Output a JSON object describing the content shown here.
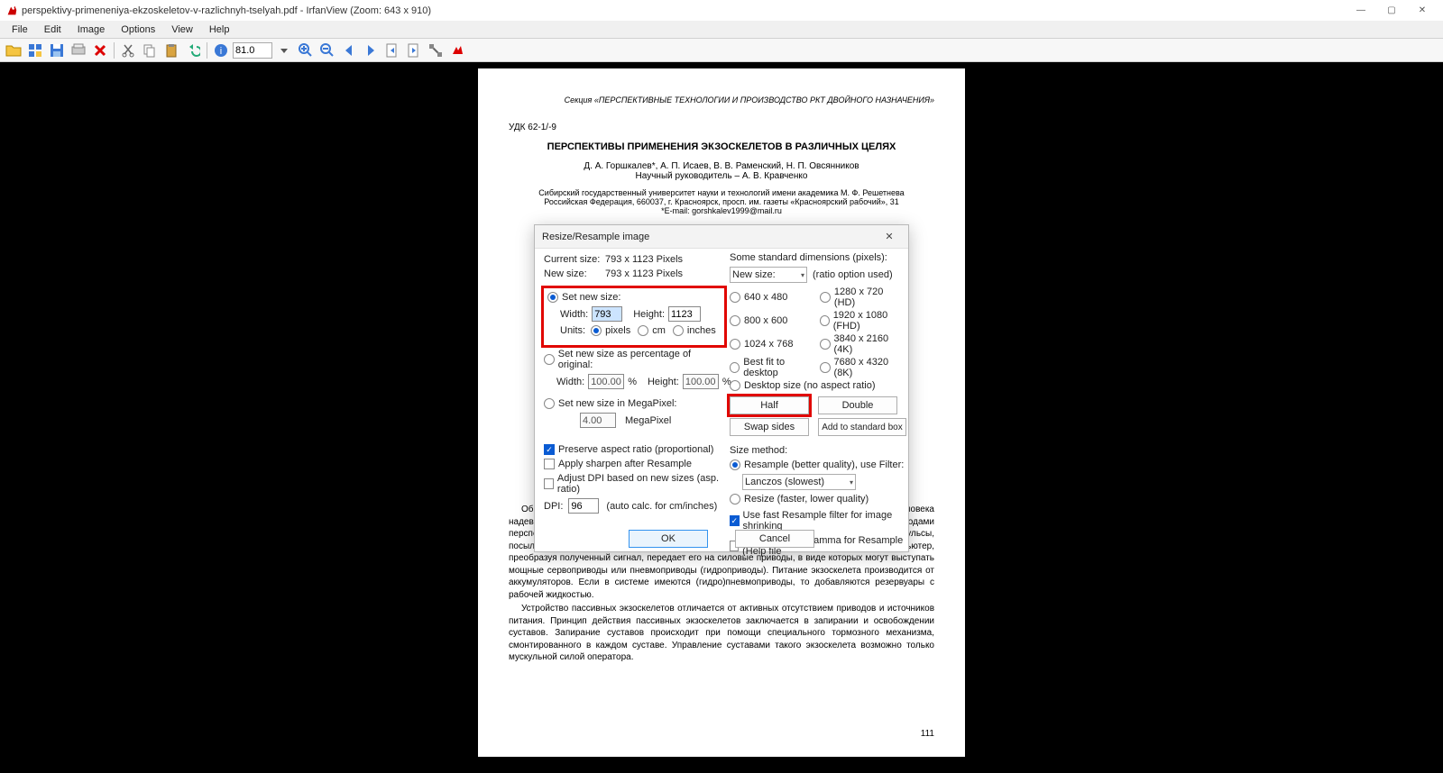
{
  "window": {
    "title": "perspektivy-primeneniya-ekzoskeletov-v-razlichnyh-tselyah.pdf - IrfanView (Zoom: 643 x 910)",
    "min": "—",
    "max": "▢",
    "close": "✕"
  },
  "menu": {
    "items": [
      "File",
      "Edit",
      "Image",
      "Options",
      "View",
      "Help"
    ]
  },
  "toolbar": {
    "zoom": "81.0"
  },
  "doc": {
    "section": "Секция «ПЕРСПЕКТИВНЫЕ ТЕХНОЛОГИИ И ПРОИЗВОДСТВО РКТ ДВОЙНОГО НАЗНАЧЕНИЯ»",
    "udk": "УДК 62-1/-9",
    "title": "ПЕРСПЕКТИВЫ ПРИМЕНЕНИЯ ЭКЗОСКЕЛЕТОВ В РАЗЛИЧНЫХ ЦЕЛЯХ",
    "authors": "Д. А. Горшкалев*, А. П. Исаев, В. В. Раменский, Н. П. Овсянников",
    "supervisor": "Научный руководитель – А. В. Кравченко",
    "affil1": "Сибирский государственный университет науки и технологий имени академика М. Ф. Решетнева",
    "affil2": "Российская Федерация, 660037, г. Красноярск, просп. им. газеты «Красноярский рабочий», 31",
    "affil3": "*E-mail: gorshkalev1999@mail.ru",
    "p1": "Общее устройство активных экзоскелетов можно описать следующим образом: на человека надевается каркас с датчиками, компьютером и приводами. Для управления приводами перспективно использовать биоэлектрические сенсоры, которые считывают нервные импульсы, посылаемые от мозга к мышцам[2]. Полученные сигналы передаются на компьютер. Компьютер, преобразуя полученный сигнал, передает его на силовые приводы, в виде которых могут выступать мощные сервоприводы или пневмоприводы (гидроприводы). Питание экзоскелета производится от аккумуляторов. Если в системе имеются (гидро)пневмоприводы, то добавляются резервуары с рабочей жидкостью.",
    "p2": "Устройство пассивных экзоскелетов отличается от активных отсутствием приводов и источников питания. Принцип действия пассивных экзоскелетов заключается в запирании и освобождении суставов. Запирание суставов происходит при помощи специального тормозного механизма, смонтированного в каждом суставе. Управление суставами такого экзоскелета возможно только мускульной силой оператора.",
    "pagenum": "111"
  },
  "dialog": {
    "title": "Resize/Resample image",
    "current_label": "Current size:",
    "current_val": "793  x  1123  Pixels",
    "new_label": "New size:",
    "new_val": "793  x  1123  Pixels",
    "set_new_size": "Set new size:",
    "width_label": "Width:",
    "width_val": "793",
    "height_label": "Height:",
    "height_val": "1123",
    "units_label": "Units:",
    "u_px": "pixels",
    "u_cm": "cm",
    "u_in": "inches",
    "set_pct": "Set new size as percentage of original:",
    "pct_w": "100.00",
    "pct_h": "100.00",
    "pct_sym": "%",
    "set_mp": "Set new size in MegaPixel:",
    "mp_val": "4.00",
    "mp_unit": "MegaPixel",
    "preserve": "Preserve aspect ratio (proportional)",
    "sharpen": "Apply sharpen after Resample",
    "adjustdpi": "Adjust DPI based on new sizes (asp. ratio)",
    "dpi_label": "DPI:",
    "dpi_val": "96",
    "dpi_hint": "(auto calc. for cm/inches)",
    "std_header": "Some standard dimensions (pixels):",
    "newsize_sel": "New size:",
    "ratio_used": "(ratio option used)",
    "std": [
      "640 x 480",
      "1280 x 720  (HD)",
      "800 x 600",
      "1920 x 1080 (FHD)",
      "1024 x 768",
      "3840 x 2160 (4K)",
      "Best fit to desktop",
      "7680 x 4320 (8K)",
      "Desktop size (no aspect ratio)"
    ],
    "half": "Half",
    "double": "Double",
    "swap": "Swap sides",
    "addstd": "Add to standard box",
    "method_label": "Size method:",
    "resample": "Resample (better quality), use Filter:",
    "filter": "Lanczos (slowest)",
    "resize_fast": "Resize (faster, lower quality)",
    "fast_shrink": "Use fast Resample filter for image shrinking",
    "gamma": "Try to improve gamma for Resample (Help file",
    "ok": "OK",
    "cancel": "Cancel"
  }
}
